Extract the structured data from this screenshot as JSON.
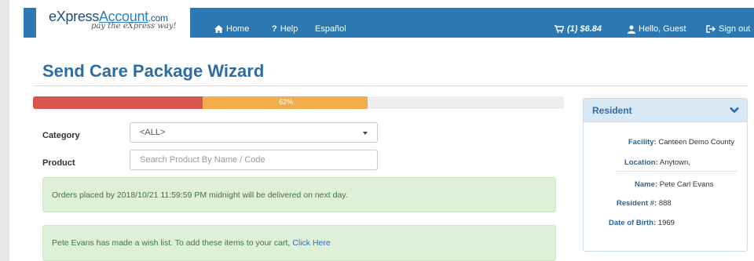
{
  "logo": {
    "brand_pre": "eXpress",
    "brand_main": "Account",
    "brand_suffix": ".com",
    "tagline": "pay the eXpress way!"
  },
  "nav": {
    "home": "Home",
    "help": "Help",
    "espanol": "Español",
    "cart": "(1) $6.84",
    "user": "Hello, Guest",
    "signout": "Sign out"
  },
  "page_title": "Send Care Package Wizard",
  "progress": {
    "segment1_percent": 32,
    "segment2_percent": 31,
    "label": "62%"
  },
  "form": {
    "category_label": "Category",
    "category_value": "<ALL>",
    "product_label": "Product",
    "product_placeholder": "Search Product By Name / Code"
  },
  "alerts": {
    "delivery": "Orders placed by 2018/10/21 11:59:59 PM midnight will be delivered on next day.",
    "wishlist": "Pete Evans has made a wish list. To add these items to your cart,",
    "wishlist_link": "Click Here"
  },
  "resident": {
    "title": "Resident",
    "facility_label": "Facility:",
    "facility_value": "Canteen Demo County",
    "location_label": "Location:",
    "location_value": "Anytown,",
    "name_label": "Name:",
    "name_value": "Pete Carl Evans",
    "resident_no_label": "Resident #:",
    "resident_no_value": "888",
    "dob_label": "Date of Birth:",
    "dob_value": "1969"
  },
  "colors": {
    "nav_blue": "#2b78b3",
    "title_blue": "#2e6da4",
    "progress_red": "#d9534f",
    "progress_orange": "#f0ad4e",
    "alert_green_bg": "#dff0d8"
  },
  "icons": {
    "home": "home-icon",
    "help": "question-icon",
    "cart": "cart-icon",
    "user": "user-icon",
    "signout": "signout-icon",
    "panel_toggle": "chevron-down-icon",
    "select_toggle": "caret-down-icon"
  }
}
